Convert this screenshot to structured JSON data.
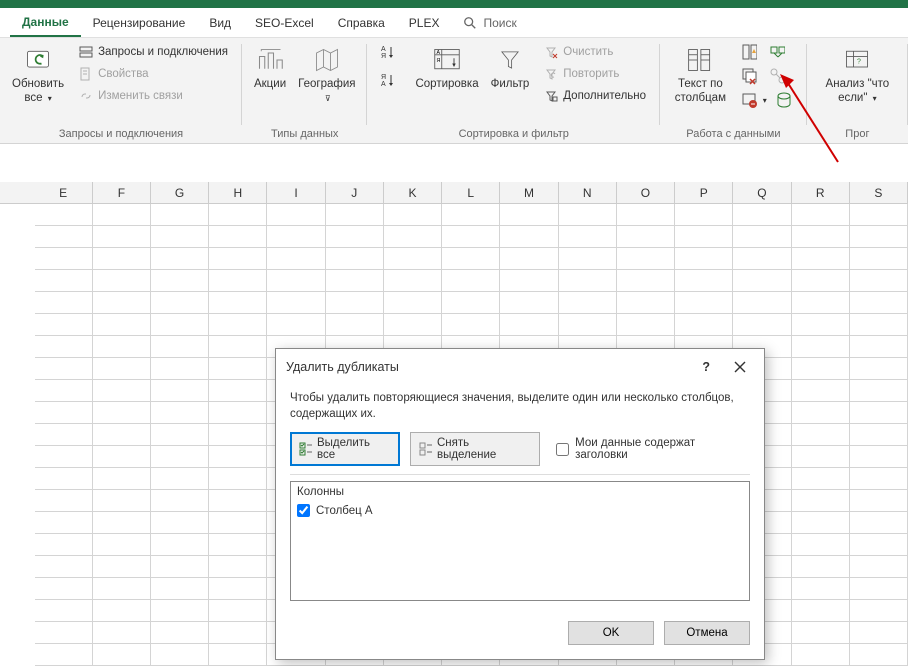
{
  "tabs": {
    "items": [
      "Данные",
      "Рецензирование",
      "Вид",
      "SEO-Excel",
      "Справка",
      "PLEX"
    ],
    "active_index": 0,
    "search_placeholder": "Поиск"
  },
  "ribbon": {
    "group1": {
      "refresh": "Обновить все",
      "queries": "Запросы и подключения",
      "props": "Свойства",
      "links": "Изменить связи",
      "label": "Запросы и подключения"
    },
    "group2": {
      "stocks": "Акции",
      "geo": "География",
      "label": "Типы данных"
    },
    "group3": {
      "sort": "Сортировка",
      "filter": "Фильтр",
      "clear": "Очистить",
      "reapply": "Повторить",
      "advanced": "Дополнительно",
      "label": "Сортировка и фильтр"
    },
    "group4": {
      "text_cols": "Текст по столбцам",
      "label": "Работа с данными"
    },
    "group5": {
      "whatif": "Анализ \"что если\"",
      "label": "Прог"
    }
  },
  "columns": [
    "E",
    "F",
    "G",
    "H",
    "I",
    "J",
    "K",
    "L",
    "M",
    "N",
    "O",
    "P",
    "Q",
    "R",
    "S"
  ],
  "dialog": {
    "title": "Удалить дубликаты",
    "desc": "Чтобы удалить повторяющиеся значения, выделите один или несколько столбцов, содержащих их.",
    "select_all": "Выделить все",
    "unselect_all": "Снять выделение",
    "headers_check": "Мои данные содержат заголовки",
    "list_head": "Колонны",
    "col_a": "Столбец A",
    "ok": "OK",
    "cancel": "Отмена"
  }
}
